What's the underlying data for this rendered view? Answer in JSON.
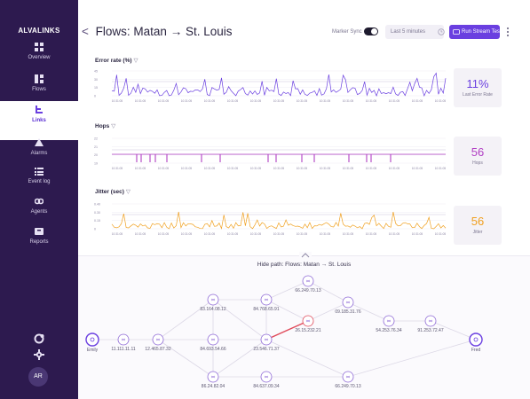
{
  "app": {
    "brand": "ALVALINKS"
  },
  "sidebar": {
    "items": [
      {
        "label": "Overview",
        "icon": "grid-icon"
      },
      {
        "label": "Flows",
        "icon": "flows-icon"
      },
      {
        "label": "Links",
        "icon": "links-icon",
        "active": true
      },
      {
        "label": "Alarms",
        "icon": "warning-icon"
      },
      {
        "label": "Event log",
        "icon": "list-icon"
      },
      {
        "label": "Agents",
        "icon": "agents-icon"
      },
      {
        "label": "Reports",
        "icon": "reports-icon"
      }
    ],
    "avatar": "AR"
  },
  "header": {
    "title_prefix": "Flows: Matan",
    "arrow": "→",
    "title_suffix": "St. Louis",
    "sync_label": "Marker Sync",
    "sync_on": true,
    "time_range": "Last 5 minutes",
    "run_button": "Run Stream Test"
  },
  "panels": [
    {
      "title": "Error rate (%)",
      "stat_value": "11%",
      "stat_label": "Last Error Rate",
      "color": "#6a3fe0",
      "y_ticks": [
        "45",
        "30",
        "15",
        "0"
      ]
    },
    {
      "title": "Hops",
      "stat_value": "56",
      "stat_label": "Hops",
      "color": "#b13fc4",
      "y_ticks": [
        "22",
        "21",
        "20",
        "19"
      ]
    },
    {
      "title": "Jitter (sec)",
      "stat_value": "56",
      "stat_label": "Jitter",
      "color": "#f0a020",
      "y_ticks": [
        "0.40",
        "0.30",
        "0.15",
        "0"
      ]
    }
  ],
  "x_tick_label": "10:31:05",
  "path": {
    "hide_label": "Hide path: Flows: Matan → St. Louis",
    "nodes": [
      {
        "label": "Emily"
      },
      {
        "label": "11.111.11.11"
      },
      {
        "label": "12.465.87.32"
      },
      {
        "label": "83.164.08.12"
      },
      {
        "label": "84.693.54.66"
      },
      {
        "label": "86.24.82.04"
      },
      {
        "label": "84.768.65.91"
      },
      {
        "label": "23.546.71.37"
      },
      {
        "label": "84.637.09.34"
      },
      {
        "label": "66.249.70.13"
      },
      {
        "label": "26.15.232.21"
      },
      {
        "label": "09.185.31.76"
      },
      {
        "label": "66.249.70.13"
      },
      {
        "label": "54.253.76.34"
      },
      {
        "label": "91.253.72.47"
      },
      {
        "label": "Fred"
      }
    ]
  },
  "colors": {
    "sidebar": "#2d1a4f",
    "accent": "#6a3fe0",
    "hops": "#b13fc4",
    "jitter": "#f0a020",
    "highlight_edge": "#e04a5a"
  }
}
